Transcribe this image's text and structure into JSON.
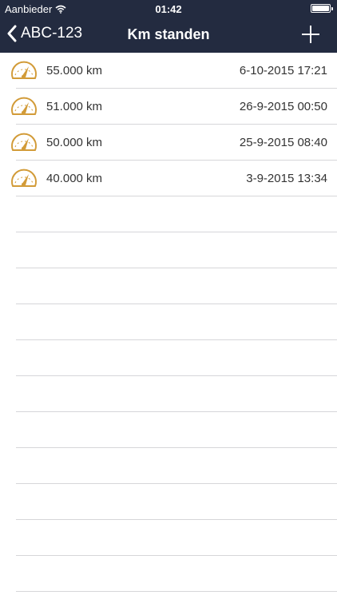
{
  "status_bar": {
    "carrier": "Aanbieder",
    "time": "01:42"
  },
  "nav": {
    "back_label": "ABC-123",
    "title": "Km standen"
  },
  "colors": {
    "header_bg": "#232b40",
    "accent": "#d29b38"
  },
  "entries": [
    {
      "km": "55.000 km",
      "date": "6-10-2015 17:21",
      "icon": "gauge-icon"
    },
    {
      "km": "51.000 km",
      "date": "26-9-2015 00:50",
      "icon": "gauge-icon"
    },
    {
      "km": "50.000 km",
      "date": "25-9-2015 08:40",
      "icon": "gauge-icon"
    },
    {
      "km": "40.000 km",
      "date": "3-9-2015 13:34",
      "icon": "gauge-icon"
    }
  ]
}
